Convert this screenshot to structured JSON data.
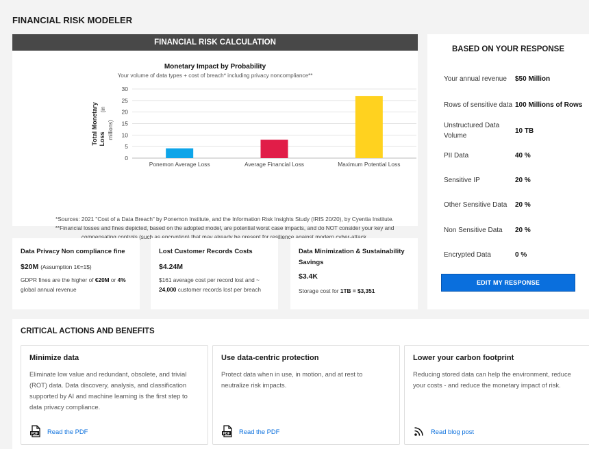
{
  "page": {
    "title": "FINANCIAL RISK MODELER"
  },
  "calc": {
    "header": "FINANCIAL RISK CALCULATION",
    "sources_line1": "*Sources: 2021 \"Cost of a Data Breach\" by Ponemon Institute, and the Information Risk Insights Study (IRIS 20/20), by Cyentia Institute.",
    "sources_line2": "**Financial losses and fines depicted, based on the adopted model, are potential worst case impacts, and do NOT consider your key and compensating controls (such as encryption) that may already be present for resilience against modern cyber-attack."
  },
  "chart_data": {
    "type": "bar",
    "title": "Monetary Impact by Probability",
    "subtitle": "Your volume of data types + cost of breach* including privacy noncompliance**",
    "ylabel_line1": "Total Monetary",
    "ylabel_line2": "Loss",
    "ylabel_unit_1": "(in",
    "ylabel_unit_2": "millions)",
    "categories": [
      "Ponemon Average Loss",
      "Average Financial Loss",
      "Maximum Potential Loss"
    ],
    "values": [
      4.24,
      8,
      27
    ],
    "colors": [
      "#0ea5e9",
      "#e11d48",
      "#ffd21f"
    ],
    "ylim": [
      0,
      30
    ],
    "yticks": [
      0,
      5,
      10,
      15,
      20,
      25,
      30
    ],
    "grid": true
  },
  "response": {
    "title": "BASED ON YOUR RESPONSE",
    "rows": [
      {
        "label": "Your annual revenue",
        "value": "$50 Million"
      },
      {
        "label": "Rows of sensitive data",
        "value": "100 Millions of Rows"
      },
      {
        "label": "Unstructured Data Volume",
        "value": "10 TB"
      },
      {
        "label": "PII Data",
        "value": "40 %"
      },
      {
        "label": "Sensitive IP",
        "value": "20 %"
      },
      {
        "label": "Other Sensitive Data",
        "value": "20 %"
      },
      {
        "label": "Non Sensitive Data",
        "value": "20 %"
      },
      {
        "label": "Encrypted Data",
        "value": "0 %"
      }
    ],
    "edit_button": "EDIT MY RESPONSE"
  },
  "metrics": {
    "privacy": {
      "title": "Data Privacy Non compliance fine",
      "value": "$20M",
      "note": "(Assumption 1€=1$)",
      "desc_pre": "GDPR fines are the higher of ",
      "desc_b1": "€20M",
      "desc_mid": " or ",
      "desc_b2": "4%",
      "desc_post": " global annual revenue"
    },
    "records": {
      "title": "Lost Customer Records Costs",
      "value": "$4.24M",
      "desc_pre": "$161 average cost per record lost and ~ ",
      "desc_b1": "24,000",
      "desc_post": " customer records lost per breach"
    },
    "minimization": {
      "title": "Data Minimization & Sustainability Savings",
      "value": "$3.4K",
      "desc_pre": "Storage cost for ",
      "desc_b1": "1TB = $3,351"
    }
  },
  "actions": {
    "title": "CRITICAL ACTIONS AND BENEFITS",
    "cards": [
      {
        "title": "Minimize data",
        "desc": "Eliminate low value and redundant, obsolete, and trivial (ROT) data. Data discovery, analysis, and classification supported by AI and machine learning is the first step to data privacy compliance.",
        "link": "Read the PDF",
        "icon": "pdf-icon"
      },
      {
        "title": "Use data-centric protection",
        "desc": "Protect data when in use, in motion, and at rest to neutralize risk impacts.",
        "link": "Read the PDF",
        "icon": "pdf-icon"
      },
      {
        "title": "Lower your carbon footprint",
        "desc": "Reducing stored data can help the environment, reduce your costs - and reduce the monetary impact of risk.",
        "link": "Read blog post",
        "icon": "rss-icon"
      }
    ]
  }
}
